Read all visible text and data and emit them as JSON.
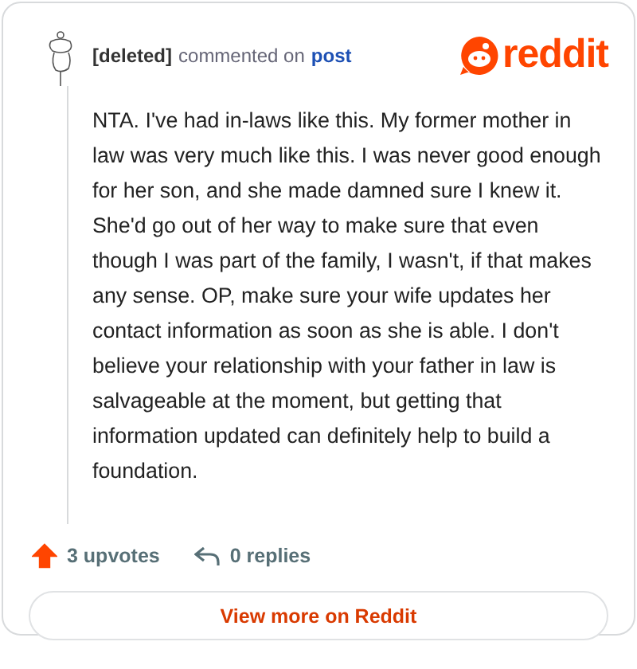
{
  "comment": {
    "author": "[deleted]",
    "action": "commented on",
    "target": "post",
    "body": "NTA. I've had in-laws like this. My former mother in law was very much like this. I was never good enough for her son, and she made damned sure I knew it. She'd go out of her way to make sure that even though I was part of the family, I wasn't, if that makes any sense. OP, make sure your wife updates her contact information as soon as she is able. I don't believe your relationship with your father in law is salvageable at the moment, but getting that information updated can definitely help to build a foundation.",
    "upvotes": "3 upvotes",
    "upvoted": true,
    "replies": "0 replies"
  },
  "logo": {
    "wordmark": "reddit"
  },
  "button": "View more on Reddit"
}
